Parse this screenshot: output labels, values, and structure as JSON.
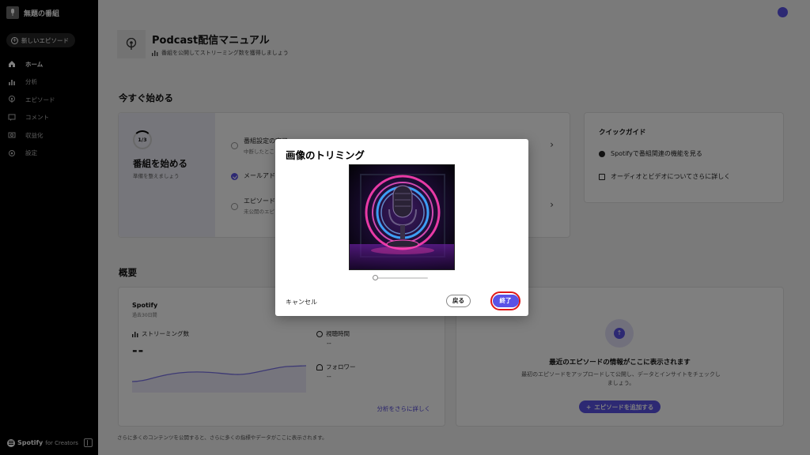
{
  "sidebar": {
    "show_name": "無題の番組",
    "new_episode": "新しいエピソード",
    "items": [
      {
        "label": "ホーム"
      },
      {
        "label": "分析"
      },
      {
        "label": "エピソード"
      },
      {
        "label": "コメント"
      },
      {
        "label": "収益化"
      },
      {
        "label": "設定"
      }
    ],
    "footer_brand": "Spotify",
    "footer_suffix": "for Creators"
  },
  "header": {
    "manual_title": "Podcast配信マニュアル",
    "manual_sub": "番組を公開してストリーミング数を獲得しましょう"
  },
  "get_started": {
    "section_title": "今すぐ始める",
    "progress": "1/3",
    "title": "番組を始める",
    "subtitle": "準備を整えましょう",
    "tasks": [
      {
        "title": "番組設定の完了",
        "sub": "中断したところから"
      },
      {
        "title": "メールアドレス",
        "sub": ""
      },
      {
        "title": "エピソード",
        "sub": "未公開のエピソード"
      }
    ]
  },
  "quick_guide": {
    "title": "クイックガイド",
    "items": [
      "Spotifyで番組関連の機能を見る",
      "オーディオとビデオについてさらに詳しく"
    ]
  },
  "overview": {
    "section_title": "概要",
    "spotify_title": "Spotify",
    "period": "過去30日間",
    "streams_label": "ストリーミング数",
    "streams_value": "--",
    "listen_time_label": "視聴時間",
    "listen_time_value": "--",
    "followers_label": "フォロワー",
    "followers_value": "--",
    "more_link": "分析をさらに詳しく"
  },
  "recent": {
    "title": "最近のエピソードの情報がここに表示されます",
    "desc": "最初のエピソードをアップロードして公開し、データとインサイトをチェックしましょう。",
    "add_button": "エピソードを追加する"
  },
  "footnote": "さらに多くのコンテンツを公開すると、さらに多くの指標やデータがここに表示されます。",
  "modal": {
    "title": "画像のトリミング",
    "zoom": 0,
    "cancel": "キャンセル",
    "back": "戻る",
    "finish": "終了"
  },
  "colors": {
    "accent": "#5b52e6",
    "highlight": "#e01818"
  }
}
